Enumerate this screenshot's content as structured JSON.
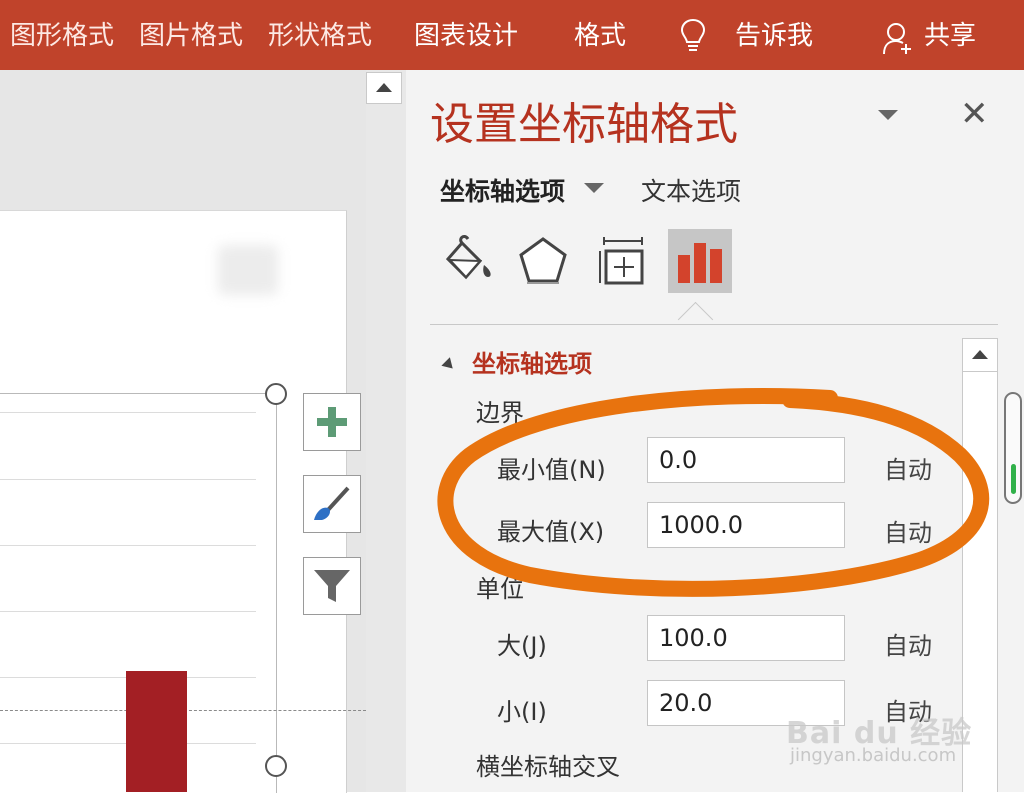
{
  "ribbon": {
    "tabs": [
      "图形格式",
      "图片格式",
      "形状格式",
      "图表设计",
      "格式"
    ],
    "tell_me": "告诉我",
    "share": "共享",
    "icons": {
      "tell_me": "lightbulb-icon",
      "share": "person-add-icon"
    }
  },
  "chart_tools": {
    "icons": [
      "plus-icon",
      "brush-icon",
      "filter-icon"
    ]
  },
  "pane": {
    "title": "设置坐标轴格式",
    "subtabs": {
      "axis_options": "坐标轴选项",
      "text_options": "文本选项"
    },
    "category_icons": [
      "fill-line-icon",
      "effects-pentagon-icon",
      "size-properties-icon",
      "axis-options-chart-icon"
    ],
    "section": "坐标轴选项",
    "bounds": {
      "label": "边界",
      "min": {
        "label": "最小值(N)",
        "value": "0.0",
        "auto": "自动"
      },
      "max": {
        "label": "最大值(X)",
        "value": "1000.0",
        "auto": "自动"
      }
    },
    "units": {
      "label": "单位",
      "major": {
        "label": "大(J)",
        "value": "100.0",
        "auto": "自动"
      },
      "minor": {
        "label": "小(I)",
        "value": "20.0",
        "auto": "自动"
      }
    },
    "cross_label": "横坐标轴交叉"
  },
  "watermark": {
    "text": "Bai du 经验",
    "url": "jingyan.baidu.com"
  },
  "colors": {
    "ribbon": "#c0432b",
    "accent": "#b5321f",
    "bar": "#a31f24",
    "annotation": "#e8730e"
  }
}
